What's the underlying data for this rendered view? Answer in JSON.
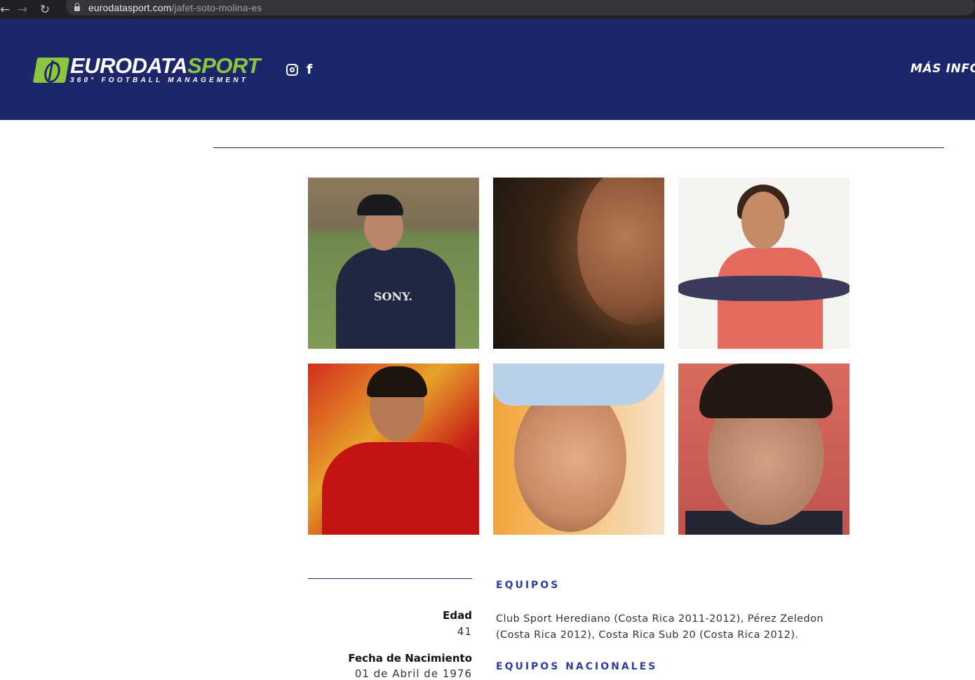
{
  "browser": {
    "url_domain": "eurodatasport.com",
    "url_path": "/jafet-soto-molina-es",
    "back_icon": "←",
    "forward_icon": "→",
    "reload_icon": "↻"
  },
  "header": {
    "logo_text_white": "EURODATA",
    "logo_text_green": "SPORT",
    "logo_tagline": "360° FOOTBALL MANAGEMENT",
    "facebook_glyph": "f",
    "nav_more_info": "MÁS INFO",
    "colors": {
      "header_bg": "#1e266b",
      "brand_green": "#8cc63f"
    }
  },
  "gallery": {
    "photos": [
      {
        "alt": "photo-1",
        "shirt_text": "SONY."
      },
      {
        "alt": "photo-2"
      },
      {
        "alt": "photo-3"
      },
      {
        "alt": "photo-4"
      },
      {
        "alt": "photo-5"
      },
      {
        "alt": "photo-6"
      }
    ]
  },
  "profile": {
    "age_label": "Edad",
    "age_value": "41",
    "birth_label": "Fecha de Nacimiento",
    "birth_value": "01 de Abril de 1976"
  },
  "sections": {
    "teams_title": "EQUIPOS",
    "teams_text": "Club Sport Herediano (Costa Rica 2011-2012), Pérez Zeledon (Costa Rica 2012), Costa Rica Sub 20 (Costa Rica 2012).",
    "national_title": "EQUIPOS NACIONALES"
  }
}
